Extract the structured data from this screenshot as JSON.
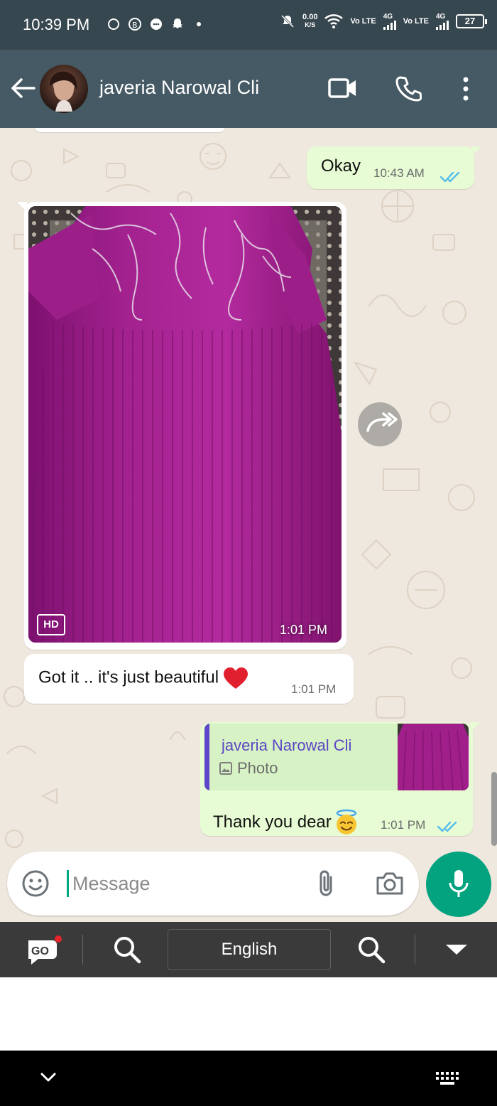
{
  "status_bar": {
    "time": "10:39 PM",
    "net_speed_value": "0.00",
    "net_speed_unit": "K/S",
    "sim1_label": "Vo LTE",
    "sim1_network": "4G",
    "sim2_label": "Vo LTE",
    "sim2_network": "4G",
    "battery": "27"
  },
  "header": {
    "contact_name": "javeria Narowal Cli",
    "icons": [
      "back-arrow-icon",
      "avatar",
      "video-call-icon",
      "voice-call-icon",
      "more-options-icon"
    ]
  },
  "messages": [
    {
      "direction": "out",
      "type": "text",
      "text": "Okay",
      "time": "10:43 AM",
      "status": "read"
    },
    {
      "direction": "in",
      "type": "image",
      "badge": "HD",
      "time": "1:01 PM",
      "content_color": "#9b1a86"
    },
    {
      "direction": "in",
      "type": "text",
      "text": "Got it .. it's just beautiful",
      "emoji": "red-heart",
      "time": "1:01 PM"
    },
    {
      "direction": "out",
      "type": "reply",
      "quoted_name": "javeria Narowal Cli",
      "quoted_kind": "Photo",
      "text": "Thank you dear",
      "emoji": "smiling-face-with-halo",
      "time": "1:01 PM",
      "status": "read"
    }
  ],
  "composer": {
    "placeholder": "Message",
    "value": ""
  },
  "keyboard_toolbar": {
    "app_label": "GO",
    "language": "English"
  },
  "colors": {
    "header": "#455a64",
    "status_bar": "#37474f",
    "chat_background": "#efe8de",
    "outgoing_bubble": "#e7fcd4",
    "incoming_bubble": "#ffffff",
    "accent": "#03a37f",
    "read_ticks": "#53bdeb",
    "quote_name": "#5b45c6"
  }
}
